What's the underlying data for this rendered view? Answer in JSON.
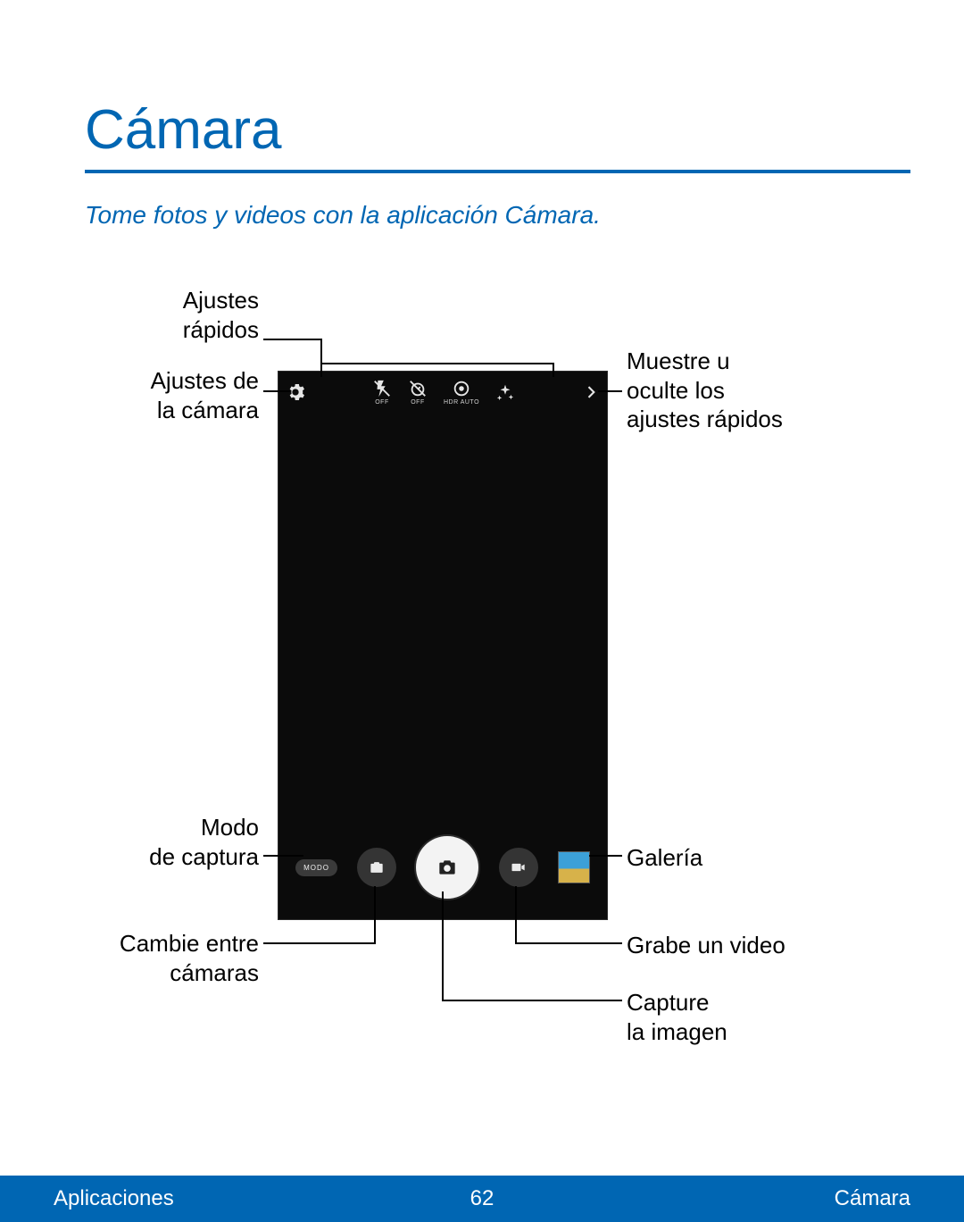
{
  "page": {
    "title": "Cámara",
    "subtitle": "Tome fotos y videos con la aplicación Cámara."
  },
  "callouts": {
    "quick_settings": "Ajustes\nrápidos",
    "camera_settings": "Ajustes de\nla cámara",
    "toggle_quick_settings": "Muestre u\noculte los\najustes rápidos",
    "capture_mode": "Modo\nde captura",
    "switch_cameras": "Cambie entre\ncámaras",
    "gallery": "Galería",
    "record_video": "Grabe un video",
    "capture_image": "Capture\nla imagen"
  },
  "camera_ui": {
    "top_icons": {
      "settings": "settings",
      "flash": {
        "sub": "OFF"
      },
      "timer": {
        "sub": "OFF"
      },
      "hdr": {
        "sub": "HDR AUTO"
      },
      "effects": "effects"
    },
    "mode_label": "MODO"
  },
  "footer": {
    "left": "Aplicaciones",
    "page": "62",
    "right": "Cámara"
  }
}
